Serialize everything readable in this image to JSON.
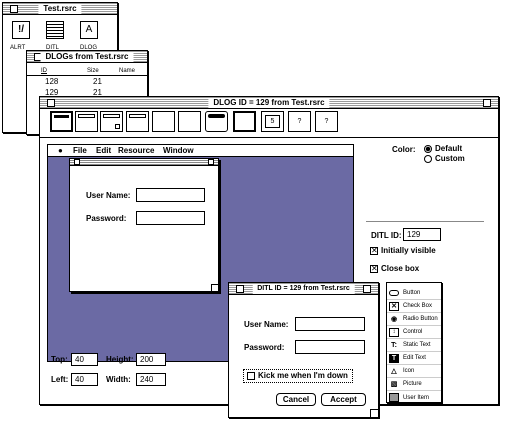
{
  "rsrc_window": {
    "title": "Test.rsrc",
    "icons": [
      "ALRT",
      "DITL",
      "DLOG"
    ]
  },
  "dlogs_window": {
    "title": "DLOGs from Test.rsrc",
    "headers": [
      "ID",
      "Size",
      "Name"
    ],
    "rows": [
      {
        "id": "128",
        "size": "21",
        "name": ""
      },
      {
        "id": "129",
        "size": "21",
        "name": ""
      }
    ]
  },
  "dlog_window": {
    "title": "DLOG ID = 129 from Test.rsrc",
    "tools": [
      "",
      "",
      "",
      "",
      "",
      "",
      "",
      "5",
      "?",
      "?"
    ],
    "menu": [
      "File",
      "Edit",
      "Resource",
      "Window"
    ],
    "preview": {
      "user_label": "User Name:",
      "pass_label": "Password:"
    },
    "color_label": "Color:",
    "color_options": [
      "Default",
      "Custom"
    ],
    "color_selected": "Default",
    "ditl_label": "DITL ID:",
    "ditl_value": "129",
    "initially_visible": "Initially visible",
    "close_box": "Close box",
    "top_label": "Top:",
    "top": "40",
    "height_label": "Height:",
    "height": "200",
    "left_label": "Left:",
    "left": "40",
    "width_label": "Width:",
    "width": "240"
  },
  "ditl_window": {
    "title": "DITL ID = 129 from Test.rsrc",
    "user_label": "User Name:",
    "pass_label": "Password:",
    "checkbox": "Kick me when I'm down",
    "cancel": "Cancel",
    "accept": "Accept"
  },
  "palette": {
    "items": [
      {
        "icon": "button-icon",
        "label": "Button"
      },
      {
        "icon": "checkbox-icon",
        "label": "Check Box"
      },
      {
        "icon": "radio-icon",
        "label": "Radio Button"
      },
      {
        "icon": "control-icon",
        "label": "Control"
      },
      {
        "icon": "static-text-icon",
        "label": "Static Text"
      },
      {
        "icon": "edit-text-icon",
        "label": "Edit Text"
      },
      {
        "icon": "alert-icon",
        "label": "Icon"
      },
      {
        "icon": "picture-icon",
        "label": "Picture"
      },
      {
        "icon": "user-item-icon",
        "label": "User Item"
      }
    ]
  },
  "colors": {
    "desktop": "#6b6aa4"
  }
}
